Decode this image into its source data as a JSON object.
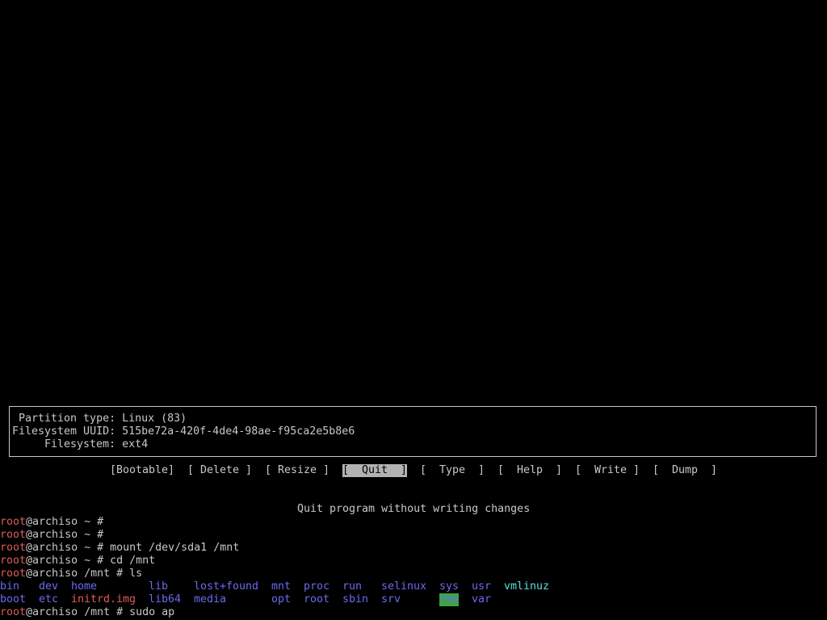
{
  "partition_info": {
    "type_label": "Partition type:",
    "type_value": "Linux (83)",
    "uuid_label": "Filesystem UUID:",
    "uuid_value": "515be72a-420f-4de4-98ae-f95ca2e5b8e6",
    "fs_label": "Filesystem:",
    "fs_value": "ext4"
  },
  "menu": {
    "bootable": "[Bootable]",
    "delete": "[ Delete ]",
    "resize": "[ Resize ]",
    "quit": "[  Quit  ]",
    "type": "[  Type  ]",
    "help": "[  Help  ]",
    "write": "[  Write ]",
    "dump": "[  Dump  ]",
    "selected": "quit"
  },
  "hint": "Quit program without writing changes",
  "terminal": {
    "user": "root",
    "host": "@archiso",
    "lines": [
      {
        "cwd": " ~ # ",
        "cmd": ""
      },
      {
        "cwd": " ~ # ",
        "cmd": ""
      },
      {
        "cwd": " ~ # ",
        "cmd": "mount /dev/sda1 /mnt"
      },
      {
        "cwd": " ~ # ",
        "cmd": "cd /mnt"
      },
      {
        "cwd": " /mnt # ",
        "cmd": "ls"
      }
    ],
    "ls_row1": [
      "bin",
      "dev",
      "home",
      "lib",
      "lost+found",
      "mnt",
      "proc",
      "run",
      "selinux",
      "sys",
      "usr",
      "vmlinuz"
    ],
    "ls_row2": [
      "boot",
      "etc",
      "initrd.img",
      "lib64",
      "media",
      "opt",
      "root",
      "sbin",
      "srv",
      "tmp",
      "var"
    ],
    "last_cwd": " /mnt # ",
    "last_cmd": "sudo ap"
  },
  "colors": {
    "background": "#000000",
    "text": "#c8c8c8",
    "prompt_user": "#e05a5a",
    "directory": "#6a6af0",
    "symlink": "#5ae0e0",
    "archive": "#e05a5a",
    "sticky_dir_bg": "#3aa83a",
    "menu_selected_bg": "#b2b2b2"
  }
}
